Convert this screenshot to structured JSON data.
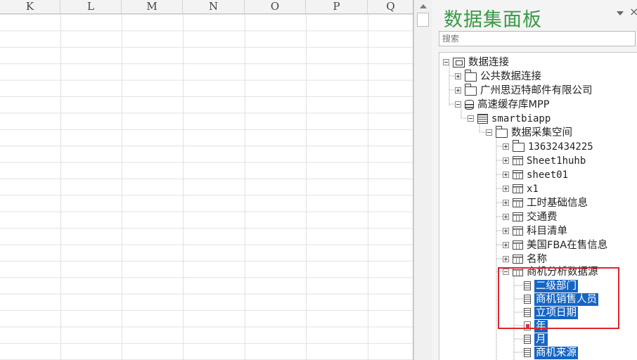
{
  "sheet": {
    "columns": [
      "K",
      "L",
      "M",
      "N",
      "O",
      "P",
      "Q"
    ]
  },
  "panel": {
    "title": "数据集面板",
    "close_glyph": "×",
    "search_placeholder": "搜索"
  },
  "tree": {
    "root": "数据连接",
    "public_connection": "公共数据连接",
    "company_folder": "广州思迈特邮件有限公司",
    "cache_db": "高速缓存库MPP",
    "smartbi_app": "smartbiapp",
    "collection_space": "数据采集空间",
    "items": [
      {
        "label": "13632434225",
        "kind": "folder"
      },
      {
        "label": "Sheet1huhb",
        "kind": "table"
      },
      {
        "label": "sheet01",
        "kind": "table"
      },
      {
        "label": "x1",
        "kind": "table"
      },
      {
        "label": "工时基础信息",
        "kind": "table"
      },
      {
        "label": "交通费",
        "kind": "table"
      },
      {
        "label": "科目清单",
        "kind": "table"
      },
      {
        "label": "美国FBA在售信息",
        "kind": "table"
      },
      {
        "label": "名称",
        "kind": "table"
      }
    ],
    "opportunity_table": "商机分析数据源",
    "fields": [
      {
        "label": "二级部门"
      },
      {
        "label": "商机销售人员"
      },
      {
        "label": "立项日期"
      },
      {
        "label": "年"
      },
      {
        "label": "月"
      },
      {
        "label": "商机来源"
      }
    ]
  },
  "colors": {
    "title_green": "#3a9a47",
    "selection_blue": "#1565c4",
    "highlight_red": "#e0242c"
  }
}
